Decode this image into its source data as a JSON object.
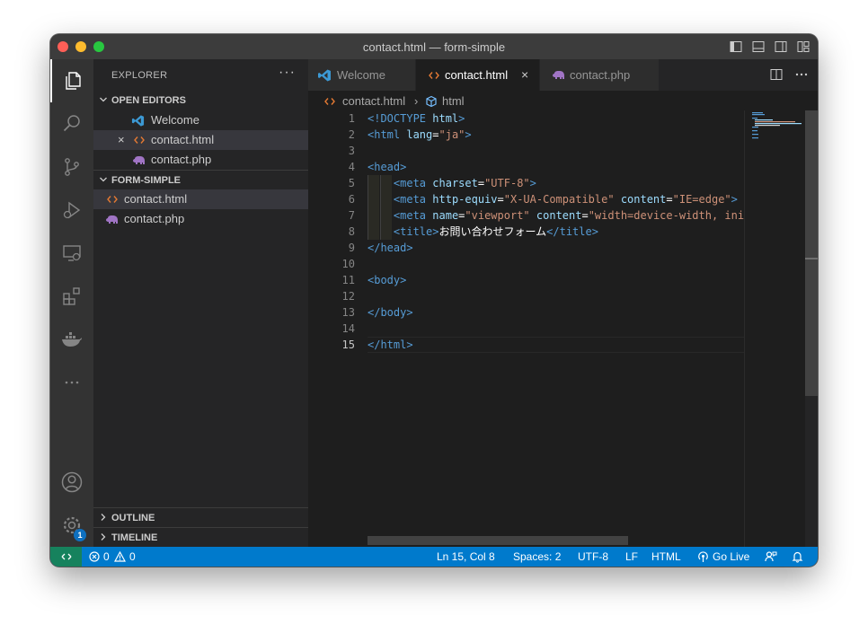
{
  "window": {
    "title": "contact.html — form-simple"
  },
  "titlebar_icons": [
    "sidebar-toggle-icon",
    "panel-toggle-icon",
    "split-layout-icon",
    "customize-layout-icon"
  ],
  "activity": [
    "files-icon",
    "search-icon",
    "source-control-icon",
    "run-debug-icon",
    "remote-explorer-icon",
    "extensions-icon",
    "docker-icon",
    "more-icon",
    "account-icon",
    "settings-gear-icon"
  ],
  "activity_badge": "1",
  "sidebar": {
    "title": "EXPLORER",
    "more": "···",
    "open_editors": {
      "label": "OPEN EDITORS",
      "items": [
        {
          "name": "Welcome",
          "icon": "vscode-icon"
        },
        {
          "name": "contact.html",
          "icon": "html-icon",
          "close": "×"
        },
        {
          "name": "contact.php",
          "icon": "php-icon"
        }
      ]
    },
    "folder": {
      "label": "FORM-SIMPLE",
      "items": [
        {
          "name": "contact.html",
          "icon": "html-icon"
        },
        {
          "name": "contact.php",
          "icon": "php-icon"
        }
      ]
    },
    "outline_label": "OUTLINE",
    "timeline_label": "TIMELINE"
  },
  "tabs": [
    {
      "label": "Welcome",
      "icon": "vscode-icon"
    },
    {
      "label": "contact.html",
      "icon": "html-icon",
      "close": "×"
    },
    {
      "label": "contact.php",
      "icon": "php-icon"
    }
  ],
  "tab_actions": [
    "split-editor-icon",
    "more-actions-icon"
  ],
  "breadcrumb": {
    "file": "contact.html",
    "separator": "›",
    "symbol": "html"
  },
  "editor": {
    "current_line": 15,
    "lines": [
      [
        {
          "t": "tag",
          "v": "<!DOCTYPE "
        },
        {
          "t": "attr",
          "v": "html"
        },
        {
          "t": "tag",
          "v": ">"
        }
      ],
      [
        {
          "t": "tag",
          "v": "<html "
        },
        {
          "t": "attr",
          "v": "lang"
        },
        {
          "t": "txt",
          "v": "="
        },
        {
          "t": "str",
          "v": "\"ja\""
        },
        {
          "t": "tag",
          "v": ">"
        }
      ],
      [],
      [
        {
          "t": "tag",
          "v": "<head>"
        }
      ],
      [
        {
          "t": "txt",
          "v": "    "
        },
        {
          "t": "tag",
          "v": "<meta "
        },
        {
          "t": "attr",
          "v": "charset"
        },
        {
          "t": "txt",
          "v": "="
        },
        {
          "t": "str",
          "v": "\"UTF-8\""
        },
        {
          "t": "tag",
          "v": ">"
        }
      ],
      [
        {
          "t": "txt",
          "v": "    "
        },
        {
          "t": "tag",
          "v": "<meta "
        },
        {
          "t": "attr",
          "v": "http-equiv"
        },
        {
          "t": "txt",
          "v": "="
        },
        {
          "t": "str",
          "v": "\"X-UA-Compatible\""
        },
        {
          "t": "txt",
          "v": " "
        },
        {
          "t": "attr",
          "v": "content"
        },
        {
          "t": "txt",
          "v": "="
        },
        {
          "t": "str",
          "v": "\"IE=edge\""
        },
        {
          "t": "tag",
          "v": ">"
        }
      ],
      [
        {
          "t": "txt",
          "v": "    "
        },
        {
          "t": "tag",
          "v": "<meta "
        },
        {
          "t": "attr",
          "v": "name"
        },
        {
          "t": "txt",
          "v": "="
        },
        {
          "t": "str",
          "v": "\"viewport\""
        },
        {
          "t": "txt",
          "v": " "
        },
        {
          "t": "attr",
          "v": "content"
        },
        {
          "t": "txt",
          "v": "="
        },
        {
          "t": "str",
          "v": "\"width=device-width, init"
        }
      ],
      [
        {
          "t": "txt",
          "v": "    "
        },
        {
          "t": "tag",
          "v": "<title>"
        },
        {
          "t": "txt",
          "v": "お問い合わせフォーム"
        },
        {
          "t": "tag",
          "v": "</title>"
        }
      ],
      [
        {
          "t": "tag",
          "v": "</head>"
        }
      ],
      [],
      [
        {
          "t": "tag",
          "v": "<body>"
        }
      ],
      [],
      [
        {
          "t": "tag",
          "v": "</body>"
        }
      ],
      [],
      [
        {
          "t": "tag",
          "v": "</html>"
        }
      ]
    ]
  },
  "status": {
    "remote_icon": "remote-icon",
    "errors": "0",
    "warnings": "0",
    "position": "Ln 15, Col 8",
    "spaces": "Spaces: 2",
    "encoding": "UTF-8",
    "eol": "LF",
    "language": "HTML",
    "golive": "Go Live",
    "feedback_icon": "feedback-icon",
    "bell_icon": "bell-icon"
  }
}
